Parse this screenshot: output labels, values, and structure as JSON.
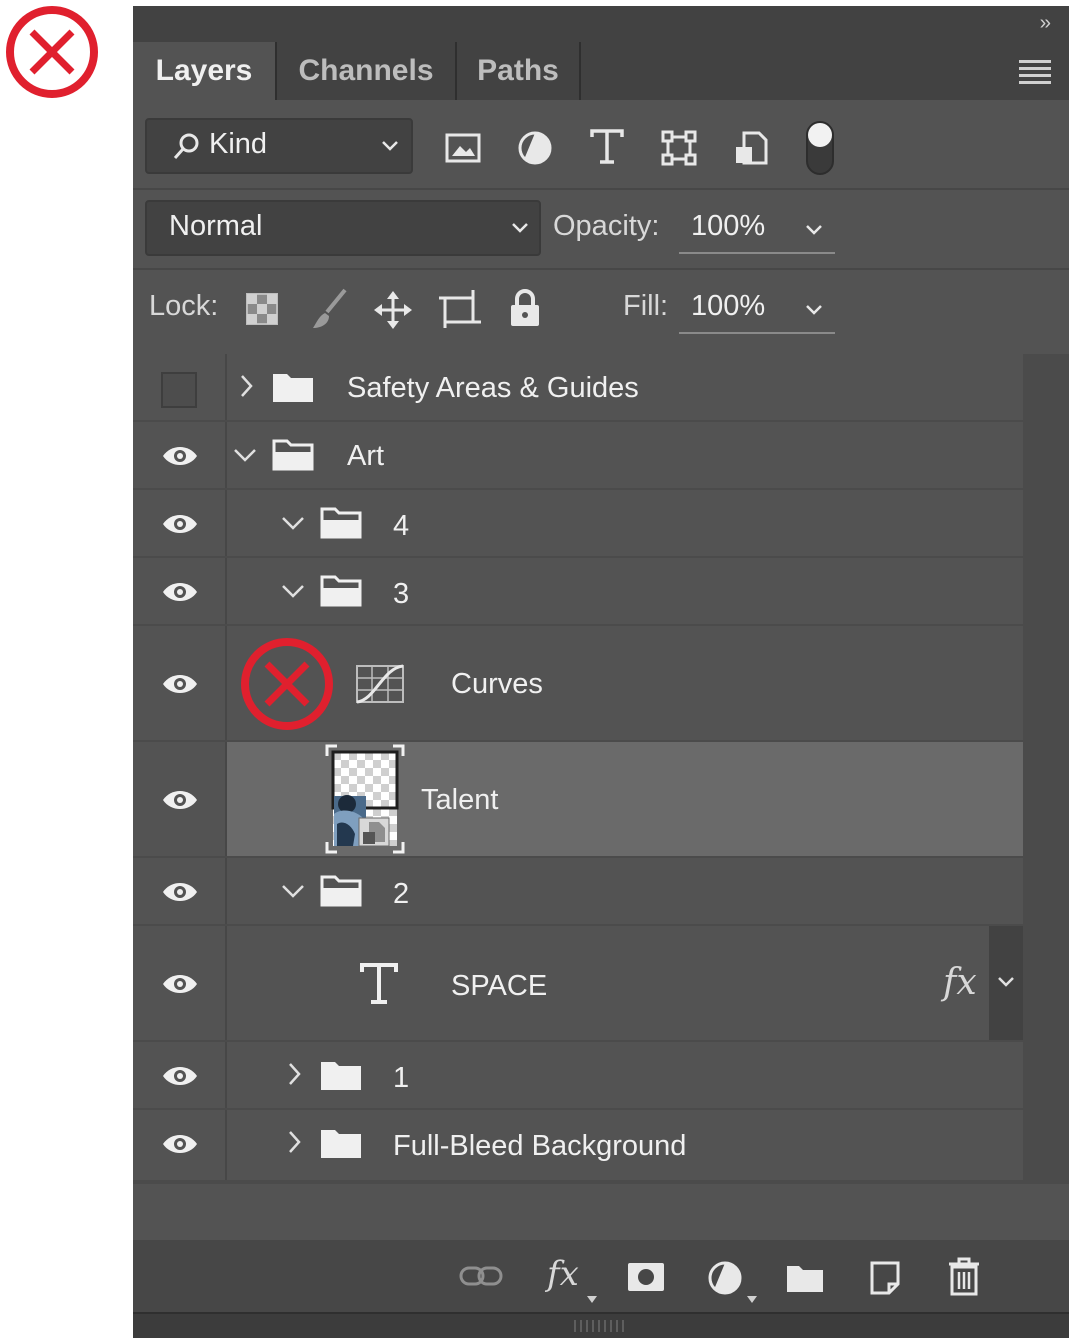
{
  "panel_tabs": [
    "Layers",
    "Channels",
    "Paths"
  ],
  "filter": {
    "kind_label": "Kind"
  },
  "blend": {
    "mode": "Normal",
    "opacity_label": "Opacity:",
    "opacity_value": "100%"
  },
  "lock": {
    "label": "Lock:",
    "fill_label": "Fill:",
    "fill_value": "100%"
  },
  "layers": [
    {
      "name": "Safety Areas & Guides",
      "type": "group",
      "expanded": false,
      "visible": false
    },
    {
      "name": "Art",
      "type": "group",
      "expanded": true,
      "visible": true
    },
    {
      "name": "4",
      "type": "group",
      "expanded": true,
      "visible": true
    },
    {
      "name": "3",
      "type": "group",
      "expanded": true,
      "visible": true
    },
    {
      "name": "Curves",
      "type": "adjustment",
      "visible": true
    },
    {
      "name": "Talent",
      "type": "smart-object",
      "visible": true,
      "selected": true
    },
    {
      "name": "2",
      "type": "group",
      "expanded": true,
      "visible": true
    },
    {
      "name": "SPACE",
      "type": "text",
      "visible": true,
      "effects": "fx"
    },
    {
      "name": "1",
      "type": "group",
      "expanded": false,
      "visible": true
    },
    {
      "name": "Full-Bleed Background",
      "type": "group",
      "expanded": false,
      "visible": true
    }
  ],
  "annotations": {
    "error_mark_color": "#e0202e"
  }
}
